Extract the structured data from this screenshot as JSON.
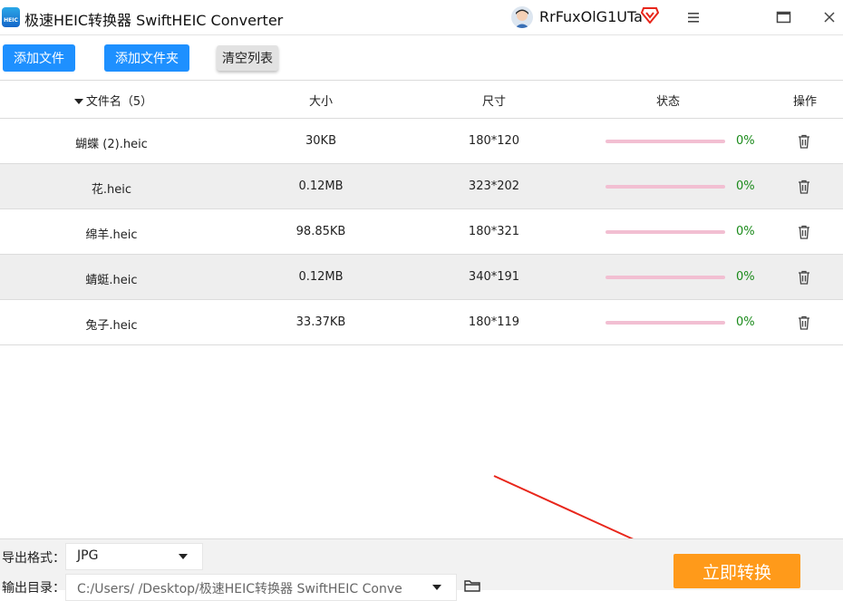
{
  "app": {
    "title": "极速HEIC转换器 SwiftHEIC Converter",
    "logo_text": "HEIC"
  },
  "user": {
    "name": "RrFuxOlG1UTa"
  },
  "toolbar": {
    "add_file": "添加文件",
    "add_folder": "添加文件夹",
    "clear_list": "清空列表"
  },
  "table": {
    "headers": {
      "name": "文件名（5）",
      "size": "大小",
      "dimensions": "尺寸",
      "status": "状态",
      "actions": "操作"
    },
    "rows": [
      {
        "name": "蝴蝶 (2).heic",
        "size": "30KB",
        "dimensions": "180*120",
        "progress_pct": "0%",
        "progress": 0
      },
      {
        "name": "花.heic",
        "size": "0.12MB",
        "dimensions": "323*202",
        "progress_pct": "0%",
        "progress": 0
      },
      {
        "name": "绵羊.heic",
        "size": "98.85KB",
        "dimensions": "180*321",
        "progress_pct": "0%",
        "progress": 0
      },
      {
        "name": "蜻蜓.heic",
        "size": "0.12MB",
        "dimensions": "340*191",
        "progress_pct": "0%",
        "progress": 0
      },
      {
        "name": "兔子.heic",
        "size": "33.37KB",
        "dimensions": "180*119",
        "progress_pct": "0%",
        "progress": 0
      }
    ]
  },
  "output": {
    "format_label": "导出格式：",
    "format_value": "JPG",
    "dir_label": "输出目录：",
    "dir_value": "C:/Users/      /Desktop/极速HEIC转换器 SwiftHEIC Conve"
  },
  "convert_button": "立即转换",
  "colors": {
    "primary_blue": "#1e90ff",
    "convert_orange": "#ff9a1a",
    "progress_pink": "#f2bfd2",
    "percent_green": "#1a8a1a",
    "annotation_red": "#e8261b"
  }
}
